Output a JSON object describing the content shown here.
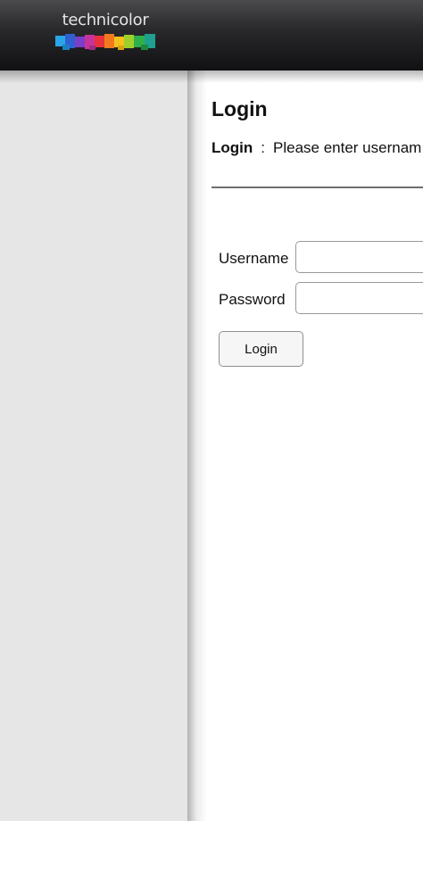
{
  "header": {
    "logo_text": "technicolor",
    "logo_icon": "technicolor-color-bar-icon",
    "logo_colors": [
      "#2aa6e8",
      "#2f5fd1",
      "#7a3ec9",
      "#c7339b",
      "#e8323c",
      "#f27a1e",
      "#f5c21b",
      "#9fcf2b",
      "#2fb14a",
      "#1fa08e"
    ]
  },
  "main": {
    "title": "Login",
    "instruction_label": "Login",
    "instruction_separator": ":",
    "instruction_text": "Please enter usernam"
  },
  "form": {
    "username_label": "Username",
    "username_value": "",
    "password_label": "Password",
    "password_value": "",
    "login_button_label": "Login"
  }
}
